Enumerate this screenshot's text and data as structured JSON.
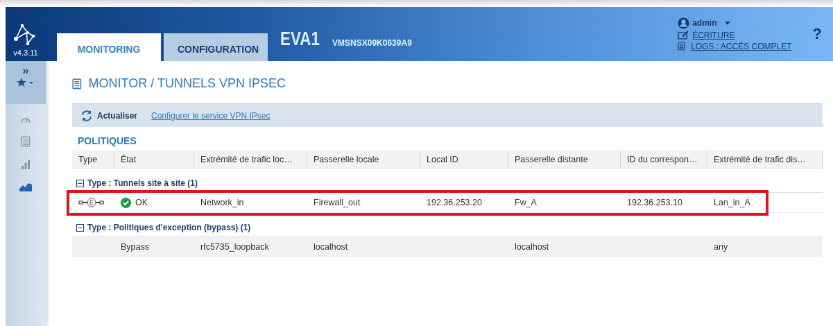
{
  "header": {
    "version": "v4.3.11",
    "tabs": [
      {
        "label": "MONITORING",
        "selected": true
      },
      {
        "label": "CONFIGURATION",
        "selected": false
      }
    ],
    "device_name": "EVA1",
    "serial": "VMSNSX09K0639A9",
    "user": "admin",
    "write_link": "ÉCRITURE",
    "logs_link": "LOGS : ACCÉS COMPLET",
    "help": "?"
  },
  "sidebar": {
    "expand": "»",
    "items": [
      {
        "kind": "gauge",
        "selected": false
      },
      {
        "kind": "list",
        "selected": false
      },
      {
        "kind": "bars",
        "selected": false
      },
      {
        "kind": "area",
        "selected": true
      }
    ]
  },
  "page": {
    "title": "MONITOR / TUNNELS VPN IPSEC",
    "toolbar": {
      "refresh": "Actualiser",
      "config_link": "Configurer le service VPN IPsec"
    },
    "section": "POLITIQUES"
  },
  "table": {
    "columns": [
      "Type",
      "État",
      "Extrémité de trafic loc…",
      "Passerelle locale",
      "Local ID",
      "Passerelle distante",
      "ID du correspon…",
      "Extrémité de trafic dis…"
    ],
    "groups": [
      {
        "label": "Type : Tunnels site à site (1)",
        "expanded": true,
        "rows": [
          {
            "kind": "tunnel",
            "highlighted": true,
            "status": "OK",
            "status_ok": true,
            "cells": [
              "Network_in",
              "Firewall_out",
              "192.36.253.20",
              "Fw_A",
              "192.36.253.10",
              "Lan_in_A"
            ]
          }
        ]
      },
      {
        "label": "Type : Politiques d'exception (bypass) (1)",
        "expanded": true,
        "rows": [
          {
            "kind": "bypass",
            "highlighted": false,
            "status": "Bypass",
            "status_ok": false,
            "cells": [
              "rfc5735_loopback",
              "localhost",
              "",
              "localhost",
              "",
              "any"
            ]
          }
        ]
      }
    ]
  }
}
